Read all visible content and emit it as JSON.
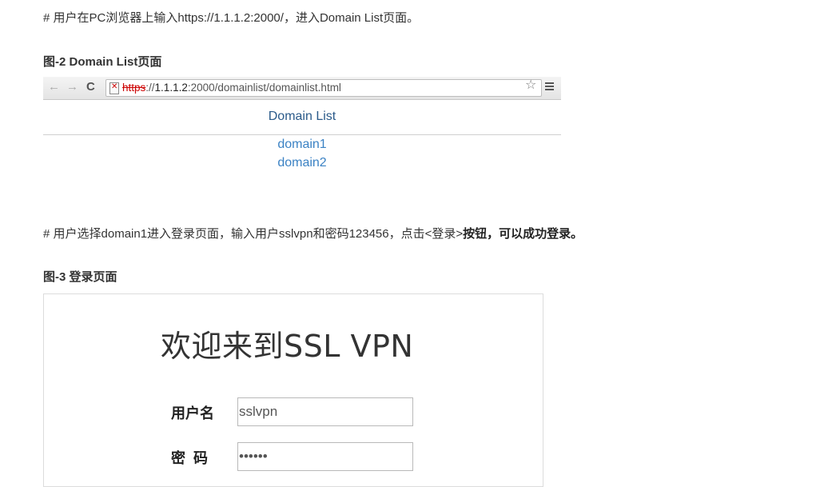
{
  "intro": "# 用户在PC浏览器上输入https://1.1.1.2:2000/，进入Domain List页面。",
  "fig2": {
    "caption": "图-2 Domain List页面",
    "url_scheme": "https",
    "url_sep": "://",
    "url_host": "1.1.1.2",
    "url_rest": ":2000/domainlist/domainlist.html",
    "heading": "Domain List",
    "domains": [
      "domain1",
      "domain2"
    ]
  },
  "step": {
    "normal": "# 用户选择domain1进入登录页面，输入用户sslvpn和密码123456，点击<登录>",
    "bold": "按钮，可以成功登录。"
  },
  "fig3": {
    "caption": "图-3 登录页面",
    "welcome": "欢迎来到SSL VPN",
    "user_label": "用户名",
    "user_value": "sslvpn",
    "pwd_label": "密  码",
    "pwd_value": "••••••"
  }
}
